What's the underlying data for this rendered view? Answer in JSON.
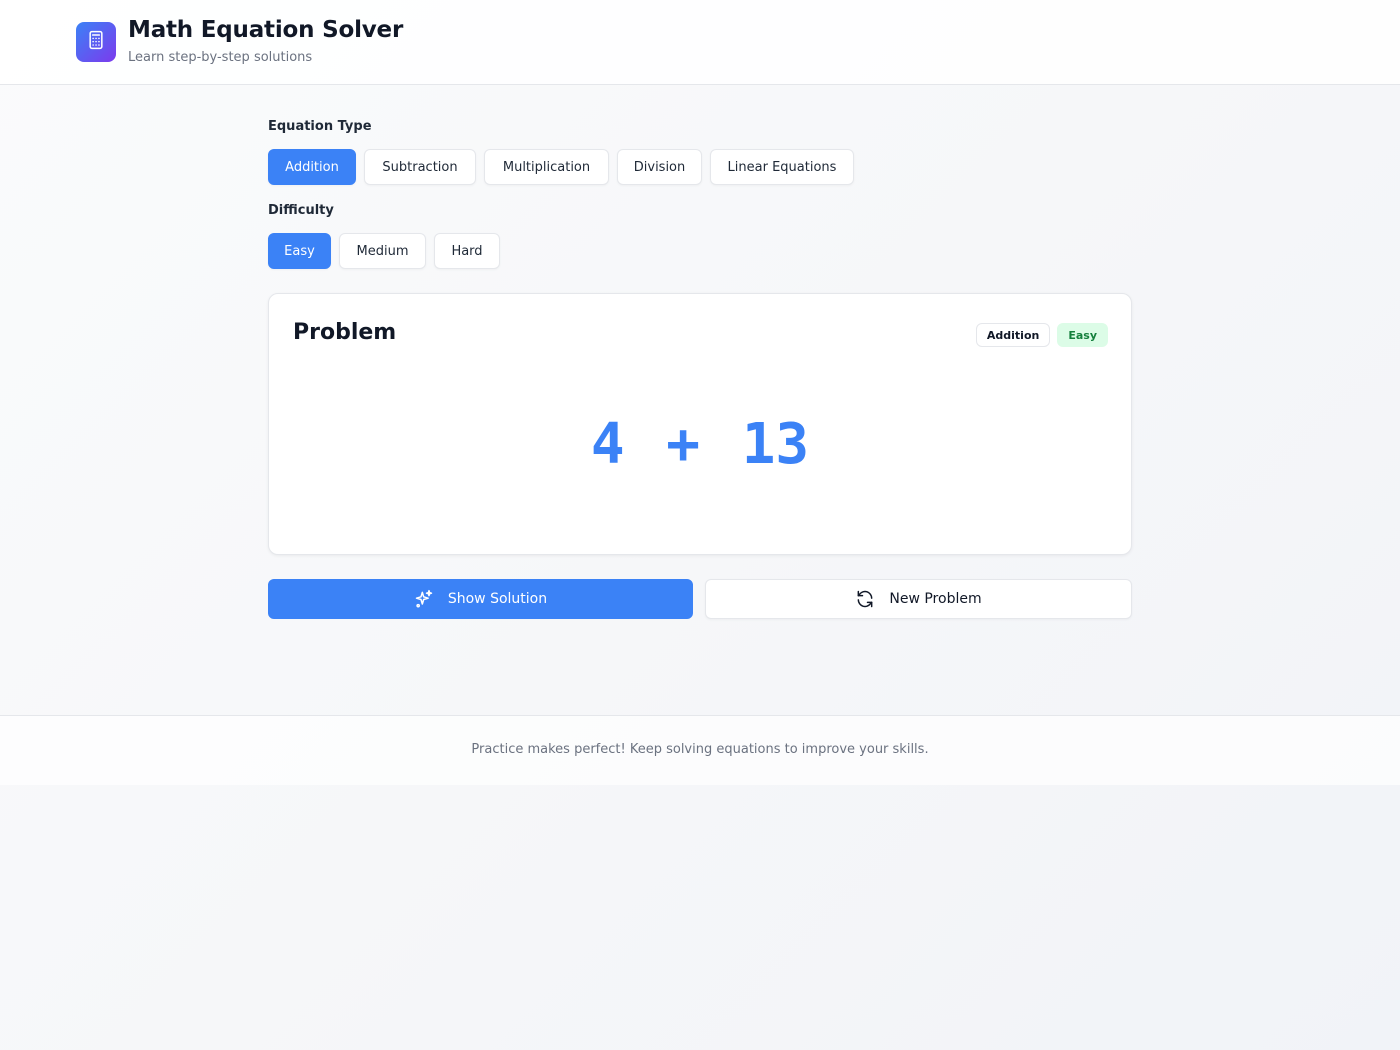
{
  "header": {
    "title": "Math Equation Solver",
    "subtitle": "Learn step-by-step solutions",
    "logo_icon": "calculator-icon"
  },
  "equation_type": {
    "label": "Equation Type",
    "options": [
      "Addition",
      "Subtraction",
      "Multiplication",
      "Division",
      "Linear Equations"
    ],
    "selected": "Addition"
  },
  "difficulty": {
    "label": "Difficulty",
    "options": [
      "Easy",
      "Medium",
      "Hard"
    ],
    "selected": "Easy"
  },
  "problem": {
    "title": "Problem",
    "type_badge": "Addition",
    "difficulty_badge": "Easy",
    "equation": "4 + 13"
  },
  "actions": {
    "show_solution": "Show Solution",
    "show_solution_icon": "sparkles-icon",
    "new_problem": "New Problem",
    "new_problem_icon": "refresh-icon"
  },
  "footer": {
    "text": "Practice makes perfect! Keep solving equations to improve your skills."
  },
  "colors": {
    "accent": "#3b82f6",
    "badge_easy_bg": "#dcfce7",
    "badge_easy_text": "#15803d"
  }
}
